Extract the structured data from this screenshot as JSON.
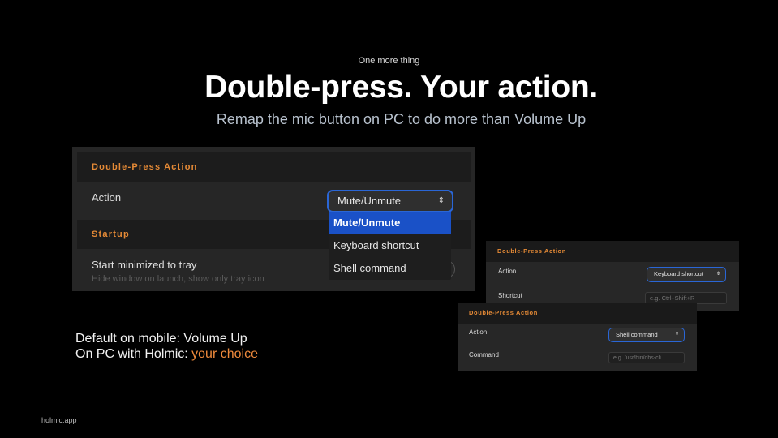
{
  "slide": {
    "eyebrow": "One more thing",
    "headline": "Double-press. Your action.",
    "subhead": "Remap the mic button on PC to do more than Volume Up",
    "footer_line1": "Default on mobile: Volume Up",
    "footer_line2_prefix": "On PC with Holmic: ",
    "footer_line2_accent": "your choice",
    "brand": "holmic.app"
  },
  "main_panel": {
    "section1_title": "Double-Press Action",
    "action_label": "Action",
    "action_value": "Mute/Unmute",
    "dropdown_options": [
      "Mute/Unmute",
      "Keyboard shortcut",
      "Shell command"
    ],
    "section2_title": "Startup",
    "startup_label": "Start minimized to tray",
    "startup_sub": "Hide window on launch, show only tray icon"
  },
  "panel_shortcut": {
    "title": "Double-Press Action",
    "action_label": "Action",
    "action_value": "Keyboard shortcut",
    "field_label": "Shortcut",
    "field_placeholder": "e.g. Ctrl+Shift+R"
  },
  "panel_command": {
    "title": "Double-Press Action",
    "action_label": "Action",
    "action_value": "Shell command",
    "field_label": "Command",
    "field_placeholder": "e.g. /usr/bin/obs-cli"
  },
  "colors": {
    "accent": "#ef8a3c",
    "section_title": "#e58a36",
    "selection_blue": "#1a51c7",
    "focus_ring": "#2a66d6"
  },
  "icons": {
    "select_chevron": "chevron-up-down-icon"
  }
}
